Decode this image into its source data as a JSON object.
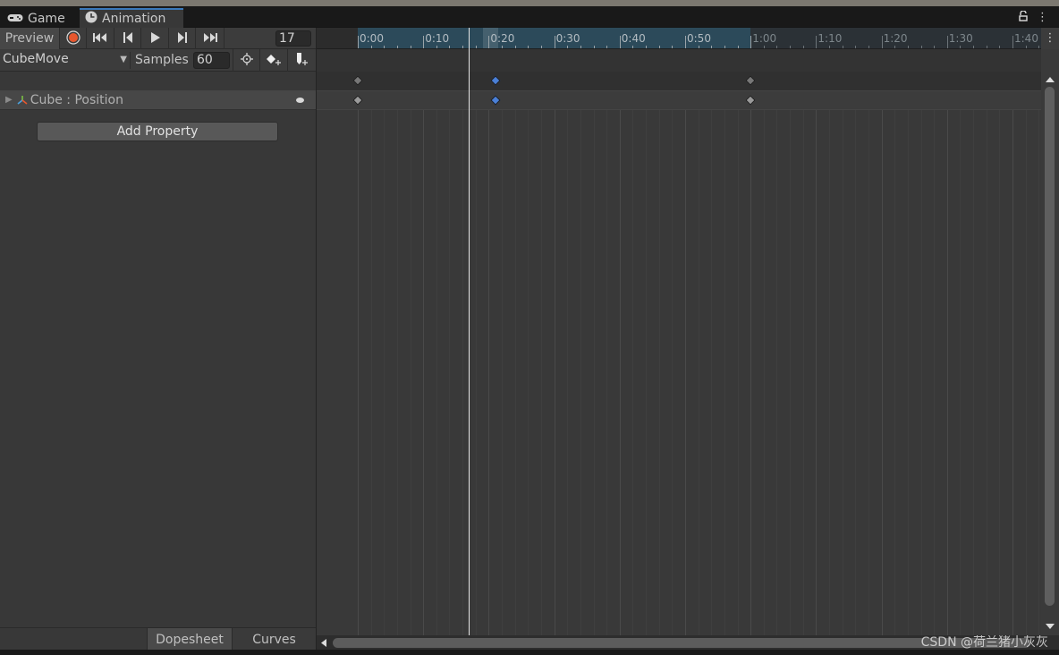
{
  "tabs": [
    {
      "label": "Game",
      "icon": "gamepad-icon",
      "active": false
    },
    {
      "label": "Animation",
      "icon": "clock-icon",
      "active": true
    }
  ],
  "window_icons": [
    "lock-icon",
    "kebab-menu-icon"
  ],
  "toolbar": {
    "preview_label": "Preview",
    "record_color": "#e8572e",
    "buttons": [
      "first-key",
      "prev-key",
      "play",
      "next-key",
      "last-key"
    ],
    "current_frame": "17"
  },
  "clip": {
    "name": "CubeMove",
    "samples_label": "Samples",
    "samples_value": "60"
  },
  "properties": [
    {
      "label": "Cube : Position"
    }
  ],
  "add_property_label": "Add Property",
  "view_tabs": {
    "dopesheet": "Dopesheet",
    "curves": "Curves"
  },
  "timeline": {
    "tick_labels": [
      "0:00",
      "0:10",
      "0:20",
      "0:30",
      "0:40",
      "0:50",
      "1:00",
      "1:10",
      "1:20",
      "1:30",
      "1:40"
    ],
    "clip_end_frame": 60,
    "playhead_frame": 17,
    "highlight_frame": 20,
    "keyframes": [
      {
        "frame": 0,
        "selected": false
      },
      {
        "frame": 21,
        "selected": true
      },
      {
        "frame": 60,
        "selected": false
      }
    ],
    "selected_key_color": "#4a7fd6",
    "key_color": "#9a9a9a"
  },
  "watermark": "CSDN @荷兰猪小灰灰"
}
